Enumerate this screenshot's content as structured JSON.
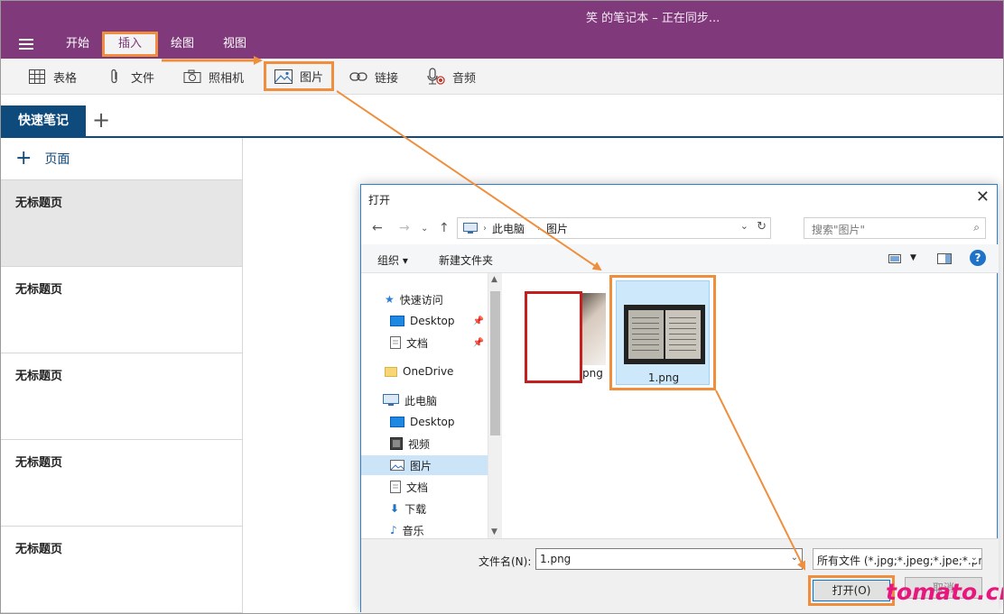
{
  "window": {
    "title": "笑 的笔记本 – 正在同步..."
  },
  "menu": {
    "tabs": [
      "开始",
      "插入",
      "绘图",
      "视图"
    ],
    "active": "插入"
  },
  "ribbon": {
    "items": [
      {
        "label": "表格",
        "icon": "table-icon"
      },
      {
        "label": "文件",
        "icon": "paperclip-icon"
      },
      {
        "label": "照相机",
        "icon": "camera-icon"
      },
      {
        "label": "图片",
        "icon": "picture-icon"
      },
      {
        "label": "链接",
        "icon": "link-icon"
      },
      {
        "label": "音频",
        "icon": "microphone-icon"
      }
    ]
  },
  "sections": {
    "current": "快速笔记",
    "add_symbol": "+"
  },
  "pages": {
    "add_label": "页面",
    "items": [
      "无标题页",
      "无标题页",
      "无标题页",
      "无标题页",
      "无标题页"
    ]
  },
  "dialog": {
    "title": "打开",
    "address": [
      "此电脑",
      "图片"
    ],
    "search_placeholder": "搜索\"图片\"",
    "commands": {
      "organize": "组织",
      "new_folder": "新建文件夹"
    },
    "help": "?",
    "tree": [
      {
        "label": "快速访问",
        "icon": "star-icon",
        "pinned": false
      },
      {
        "label": "Desktop",
        "icon": "desktop-icon",
        "pinned": true
      },
      {
        "label": "文档",
        "icon": "document-icon",
        "pinned": true
      },
      {
        "label": "OneDrive",
        "icon": "folder-icon",
        "pinned": false
      },
      {
        "label": "此电脑",
        "icon": "computer-icon",
        "pinned": false
      },
      {
        "label": "Desktop",
        "icon": "desktop-icon",
        "pinned": false
      },
      {
        "label": "视频",
        "icon": "video-icon",
        "pinned": false
      },
      {
        "label": "图片",
        "icon": "picture-icon",
        "pinned": false
      },
      {
        "label": "文档",
        "icon": "document-icon",
        "pinned": false
      },
      {
        "label": "下载",
        "icon": "download-icon",
        "pinned": false
      },
      {
        "label": "音乐",
        "icon": "music-icon",
        "pinned": false
      }
    ],
    "selected_tree_item": "图片",
    "files": [
      {
        "name": "png",
        "redacted": true
      },
      {
        "name": "1.png",
        "selected": true
      }
    ],
    "filename_label": "文件名(N):",
    "filename_value": "1.png",
    "filetype_value": "所有文件 (*.jpg;*.jpeg;*.jpe;*.png",
    "open_button": "打开(O)",
    "cancel_button": "取消"
  },
  "watermark": "tomato.cm",
  "colors": {
    "brand": "#80397b",
    "section": "#0f4a7d",
    "highlight": "#ef8f3e",
    "watermark": "#e8177d"
  }
}
